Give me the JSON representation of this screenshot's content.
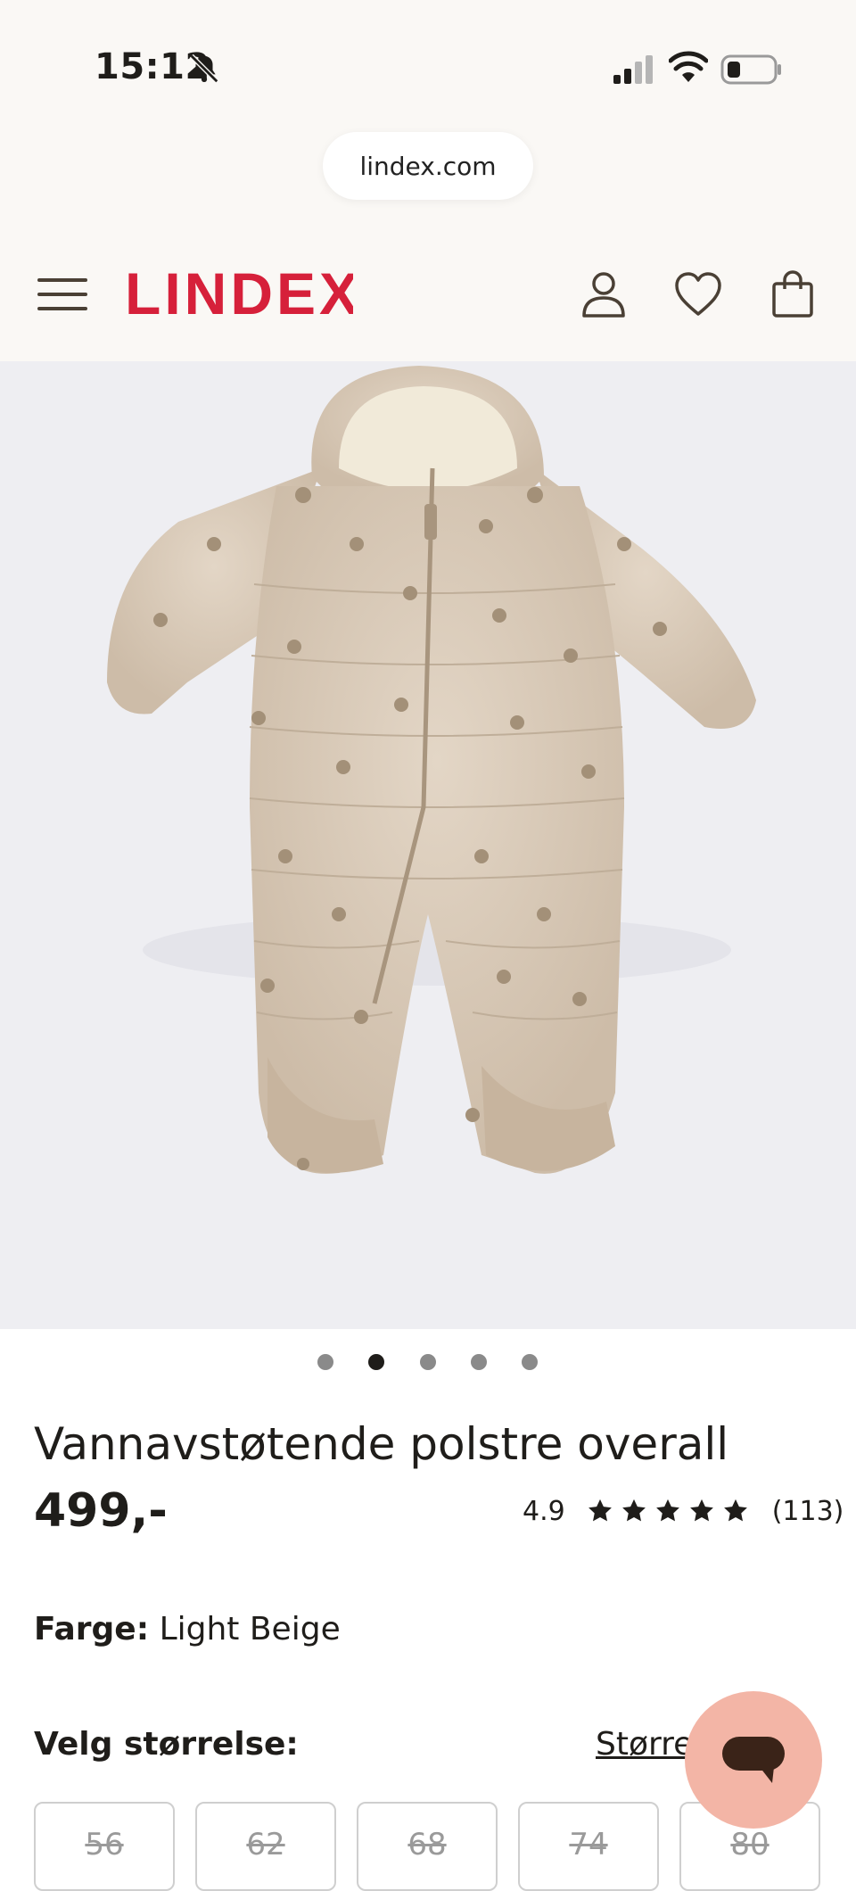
{
  "status_bar": {
    "time": "15:12"
  },
  "browser": {
    "url": "lindex.com"
  },
  "header": {
    "brand": "LINDEX"
  },
  "colors": {
    "brand_red": "#d6203a",
    "chat_bubble": "#f3b5a6",
    "text": "#1f1d1a"
  },
  "gallery": {
    "image_count": 5,
    "active_index": 1
  },
  "product": {
    "title": "Vannavstøtende polstre overall",
    "price": "499,-",
    "rating": {
      "score": "4.9",
      "stars": 5,
      "count": "(113)"
    },
    "color_label": "Farge:",
    "color_value": "Light Beige",
    "size_label": "Velg størrelse:",
    "size_guide": "Størrel",
    "sizes": [
      "56",
      "62",
      "68",
      "74",
      "80"
    ]
  },
  "icons": [
    "bell-slash-icon",
    "signal-icon",
    "wifi-icon",
    "battery-icon",
    "menu-icon",
    "account-icon",
    "heart-icon",
    "bag-icon",
    "star-icon",
    "chat-icon"
  ]
}
